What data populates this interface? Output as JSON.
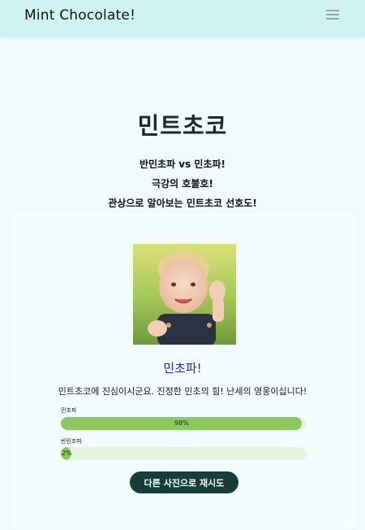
{
  "navbar": {
    "brand": "Mint Chocolate!",
    "menu_icon": "hamburger-menu-icon"
  },
  "hero": {
    "title": "민트초코",
    "taglines": [
      "반민초파 vs 민초파!",
      "극강의 호불호!",
      "관상으로 알아보는 민트초코 선호도!"
    ]
  },
  "result": {
    "photo_alt": "baby photo",
    "type": "민초파!",
    "description": "민트초코에 진심이시군요. 진정한 민초의 힘! 난세의 영웅이십니다!",
    "bars": [
      {
        "label": "민초파",
        "percent_text": "98%",
        "value": 0.98
      },
      {
        "label": "반민초파",
        "percent_text": "2%",
        "value": 0.02
      }
    ],
    "retry_label": "다른 사진으로 재시도"
  },
  "colors": {
    "navbar": "#cff3f2",
    "background": "#eefbfa",
    "result_type": "#2222cc",
    "bar_fill": "#8cc860",
    "bar_track": "#e5f3df",
    "button": "#163c3c"
  }
}
